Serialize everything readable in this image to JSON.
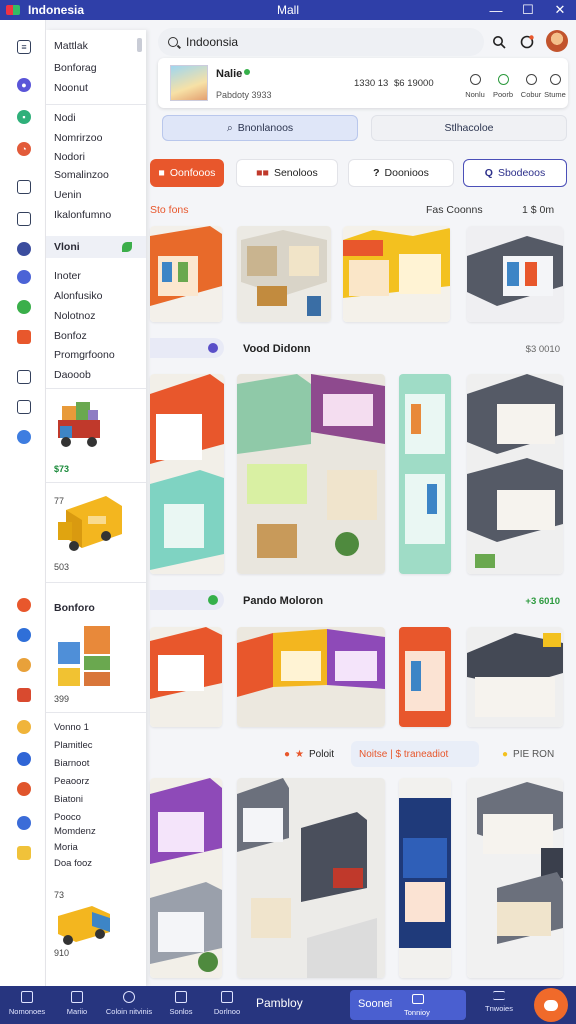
{
  "window": {
    "app_name": "Indonesia",
    "title": "Mall",
    "buttons": [
      "—",
      "☐",
      "✕"
    ]
  },
  "rail": {
    "icons": [
      "list-icon",
      "chat-icon",
      "cart-icon",
      "chart-icon",
      "store-icon",
      "user-icon",
      "grid-icon",
      "mail-icon",
      "book-icon",
      "info-icon"
    ]
  },
  "panel": {
    "items_group1": [
      "Mattlak",
      "Bonforag",
      "Noonut"
    ],
    "items_group2": [
      "Nodi",
      "Nomrirzoo",
      "Nodori",
      "Somalinzoo",
      "Uenin",
      "Ikalonfumno"
    ],
    "active_item": "Vloni",
    "items_group3": [
      "Inoter",
      "Alonfusiko",
      "Nolotnoz",
      "Bonfoz",
      "Promgrfoono",
      "Daooob"
    ],
    "price_1": "$73",
    "price_2": "77",
    "price_3": "503",
    "section_title": "Bonforo",
    "price_4": "399",
    "items_group4": [
      "Vonno 1",
      "Plamitlec",
      "Biarnoot",
      "Peaoorz",
      "Biatoni",
      "Pooco",
      "Momdenz",
      "Moria",
      "Doa fooz"
    ],
    "price_5": "73",
    "price_6": "910"
  },
  "header": {
    "search_value": "Indoonsia",
    "search_placeholder": "Search"
  },
  "store": {
    "name": "Nalie",
    "subtitle": "Pabdoty 3933",
    "stats": [
      "1330 13",
      "$6 19000"
    ],
    "actions": [
      {
        "label": "Nonlu",
        "icon": "pin-icon"
      },
      {
        "label": "Poorb",
        "icon": "status-icon"
      },
      {
        "label": "Cobur",
        "icon": "heart-icon"
      },
      {
        "label": "Stume",
        "icon": "user-icon"
      }
    ]
  },
  "tabs": {
    "active": "Bnonlanoos",
    "other": "Stlhacoloe"
  },
  "filters": [
    {
      "label": "Oonfooos",
      "glyph": "■"
    },
    {
      "label": "Senoloos",
      "glyph": "■■"
    },
    {
      "label": "Doonioos",
      "glyph": "?"
    },
    {
      "label": "Sbodeoos",
      "glyph": "Q"
    }
  ],
  "row1": {
    "left": "Sto fons",
    "mid": "Fas Coonns",
    "right": "1 $ 0m"
  },
  "section2": {
    "title": "Vood Didonn",
    "count": "$3 0010"
  },
  "section3": {
    "title": "Pando Moloron",
    "count": "+3 6010"
  },
  "section4": {
    "chip1": "Poloit",
    "chip2": "Noitse | $ traneadiot",
    "chip3": "PIE RON"
  },
  "bottom_nav": {
    "items": [
      "Nomonoes",
      "Mariio",
      "Coloin nitvinis",
      "Sonlos",
      "Dorlnoo"
    ],
    "center": "Pambloy",
    "main_label": "Soonei",
    "main_sub": "Tonnioy",
    "right_label": "Tnwoies"
  },
  "colors": {
    "brand": "#2f3fa8",
    "accent_orange": "#e8572c",
    "success": "#2c9a3e",
    "violet": "#4b4fb8"
  }
}
